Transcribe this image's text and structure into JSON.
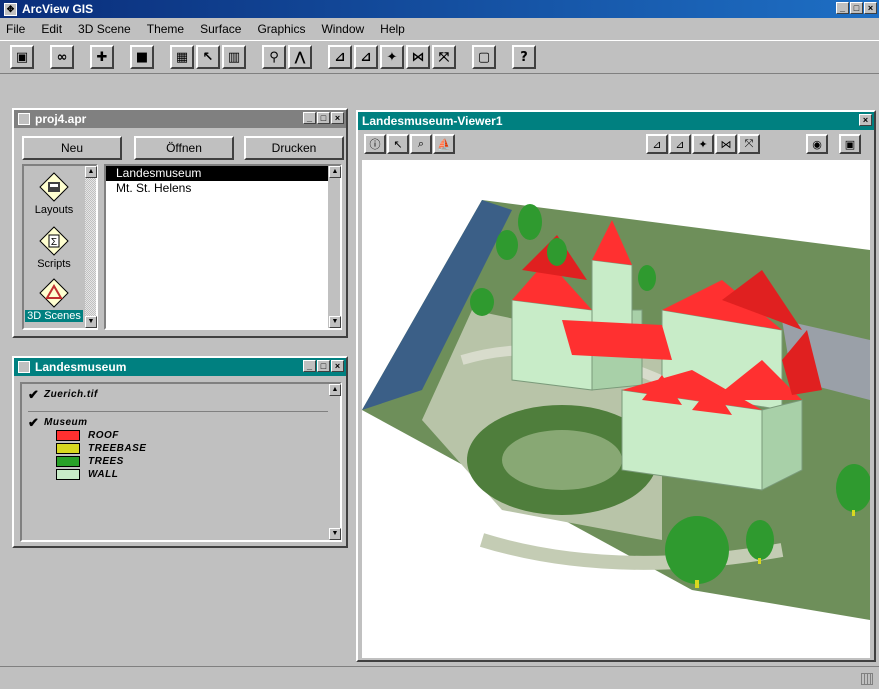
{
  "app": {
    "title": "ArcView GIS"
  },
  "menu": [
    "File",
    "Edit",
    "3D Scene",
    "Theme",
    "Surface",
    "Graphics",
    "Window",
    "Help"
  ],
  "toolbar": {
    "buttons": [
      {
        "name": "save-icon",
        "glyph": "▣"
      },
      {
        "name": "glasses-icon",
        "glyph": "∞"
      },
      {
        "name": "add-theme-icon",
        "glyph": "✚"
      },
      {
        "name": "layout-icon",
        "glyph": "■"
      },
      {
        "name": "theme-properties-icon",
        "glyph": "▦"
      },
      {
        "name": "edit-legend-icon",
        "glyph": "↖"
      },
      {
        "name": "open-table-icon",
        "glyph": "▥"
      },
      {
        "name": "find-icon",
        "glyph": "⚲"
      },
      {
        "name": "query-icon",
        "glyph": "⋀"
      },
      {
        "name": "zoom-to-full-icon",
        "glyph": "⊿"
      },
      {
        "name": "zoom-to-active-icon",
        "glyph": "⊿"
      },
      {
        "name": "zoom-to-selected-icon",
        "glyph": "✦"
      },
      {
        "name": "zoom-in-icon",
        "glyph": "⋈"
      },
      {
        "name": "zoom-out-icon",
        "glyph": "⤧"
      },
      {
        "name": "select-none-icon",
        "glyph": "▢"
      },
      {
        "name": "help-icon",
        "glyph": "?"
      }
    ]
  },
  "project": {
    "title": "proj4.apr",
    "buttons": {
      "new": "Neu",
      "open": "Öffnen",
      "print": "Drucken"
    },
    "doc_types": [
      {
        "label": "Layouts",
        "icon": "layouts-icon"
      },
      {
        "label": "Scripts",
        "icon": "scripts-icon"
      },
      {
        "label": "3D Scenes",
        "icon": "scene-icon",
        "selected": true
      }
    ],
    "documents": [
      {
        "label": "Landesmuseum",
        "selected": true
      },
      {
        "label": "Mt. St. Helens",
        "selected": false
      }
    ]
  },
  "legend": {
    "title": "Landesmuseum",
    "themes": [
      {
        "name": "Zuerich.tif",
        "checked": true,
        "classes": []
      },
      {
        "name": "Museum",
        "checked": true,
        "classes": [
          {
            "label": "ROOF",
            "color": "#ff3030"
          },
          {
            "label": "TREEBASE",
            "color": "#d8d820"
          },
          {
            "label": "TREES",
            "color": "#28a028"
          },
          {
            "label": "WALL",
            "color": "#c8ecc8"
          }
        ]
      }
    ]
  },
  "viewer": {
    "title": "Landesmuseum-Viewer1",
    "tools": [
      {
        "name": "identify-icon",
        "glyph": "ⓘ"
      },
      {
        "name": "navigate-icon",
        "glyph": "↖"
      },
      {
        "name": "zoom-tool-icon",
        "glyph": "⌕"
      },
      {
        "name": "pan-tool-icon",
        "glyph": "⛵"
      }
    ],
    "nav_buttons": [
      {
        "name": "view-full-icon",
        "glyph": "⊿"
      },
      {
        "name": "view-active-icon",
        "glyph": "⊿"
      },
      {
        "name": "view-selected-icon",
        "glyph": "✦"
      },
      {
        "name": "view-zoom-in-icon",
        "glyph": "⋈"
      },
      {
        "name": "view-zoom-out-icon",
        "glyph": "⤧"
      }
    ],
    "extra_buttons": [
      {
        "name": "rotate-icon",
        "glyph": "◉"
      },
      {
        "name": "view-save-icon",
        "glyph": "▣"
      }
    ]
  }
}
